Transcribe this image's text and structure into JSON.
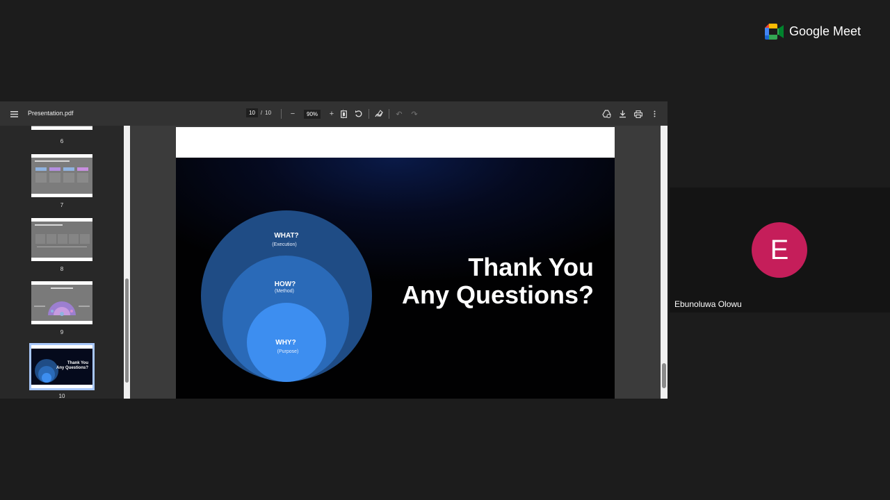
{
  "viewer": {
    "file_name": "Presentation.pdf",
    "current_page": "10",
    "page_separator": "/",
    "total_pages": "10",
    "zoom": "90%",
    "zoom_out_label": "−",
    "zoom_in_label": "+"
  },
  "thumbnails": [
    {
      "number": "6"
    },
    {
      "number": "7"
    },
    {
      "number": "8"
    },
    {
      "number": "9"
    },
    {
      "number": "10",
      "selected": true,
      "title_line1": "Thank You",
      "title_line2": "Any Questions?"
    }
  ],
  "slide": {
    "outer_title": "WHAT?",
    "outer_sub": "(Execution)",
    "mid_title": "HOW?",
    "mid_sub": "(Method)",
    "inner_title": "WHY?",
    "inner_sub": "(Purpose)",
    "heading_line1": "Thank You",
    "heading_line2": "Any Questions?"
  },
  "meet": {
    "brand_name": "Google Meet",
    "participant_initial": "E",
    "participant_name": "Ebunoluwa Olowu",
    "avatar_color": "#c51e5a"
  },
  "icons": [
    "menu-icon",
    "fit-page-icon",
    "rotate-icon",
    "annotate-icon",
    "undo-icon",
    "redo-icon",
    "drive-icon",
    "download-icon",
    "print-icon",
    "more-icon"
  ]
}
